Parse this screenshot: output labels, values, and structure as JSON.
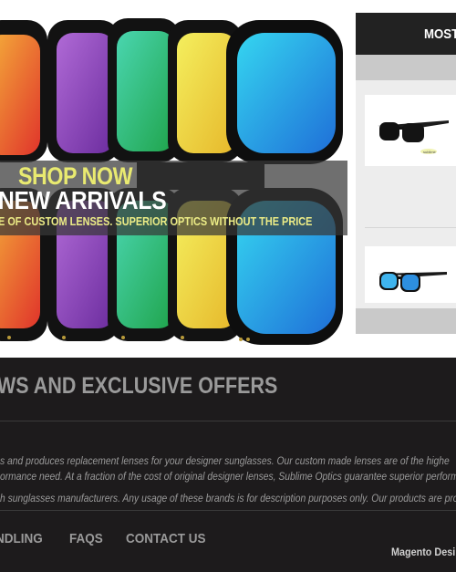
{
  "banner": {
    "shop_now": "SHOP NOW",
    "new_arrivals": "NEW ARRIVALS",
    "tagline": "E OF CUSTOM LENSES. SUPERIOR OPTICS WITHOUT THE PRICE",
    "lens_colors": [
      "#e8463a",
      "#8a45b5",
      "#2ec278",
      "#e6dc3c",
      "#2aa6e8"
    ],
    "overlay_color": "#373737",
    "shop_now_color": "#e9ea70"
  },
  "sidebar": {
    "title": "MOST",
    "products": [
      {
        "image": "black-sunglasses",
        "brand_mark": "sublime"
      },
      {
        "image": "blue-mirror-sunglasses",
        "brand_mark": ""
      }
    ]
  },
  "footer": {
    "news_title": "WS AND EXCLUSIVE OFFERS",
    "description_lines": [
      "s and produces replacement lenses for your designer sunglasses. Our custom made lenses are of the highe",
      "ormance need. At a fraction of the cost of original designer lenses, Sublime Optics guarantee superior performa",
      "h sunglasses manufacturers. Any usage of these brands is for description purposes only. Our products are pro"
    ],
    "nav": [
      "NDLING",
      "FAQS",
      "CONTACT US"
    ],
    "credit": "Magento Desi",
    "background": "#1d1b1c"
  }
}
